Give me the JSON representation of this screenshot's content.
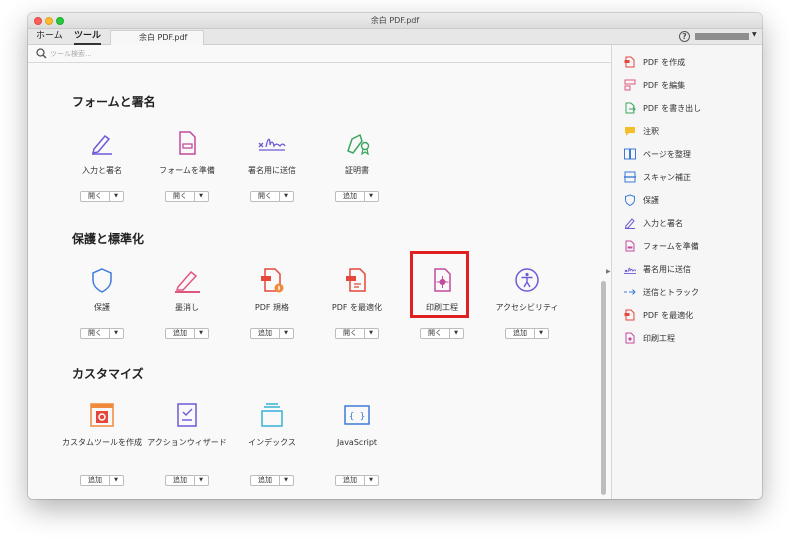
{
  "window": {
    "title": "余白 PDF.pdf"
  },
  "nav": {
    "home": "ホーム",
    "tools": "ツール",
    "doc_tab": "余白 PDF.pdf",
    "help": "?"
  },
  "search": {
    "placeholder": "ツール検索..."
  },
  "sections": [
    {
      "title": "フォームと署名",
      "tools": [
        {
          "name": "入力と署名",
          "button": "開く",
          "icon": "pen-sign-icon"
        },
        {
          "name": "フォームを準備",
          "button": "開く",
          "icon": "form-document-icon"
        },
        {
          "name": "署名用に送信",
          "button": "開く",
          "icon": "signature-icon"
        },
        {
          "name": "証明書",
          "button": "追加",
          "icon": "certificate-pen-icon"
        }
      ]
    },
    {
      "title": "保護と標準化",
      "tools": [
        {
          "name": "保護",
          "button": "開く",
          "icon": "shield-icon"
        },
        {
          "name": "墨消し",
          "button": "追加",
          "icon": "redact-marker-icon"
        },
        {
          "name": "PDF 規格",
          "button": "追加",
          "icon": "pdf-standards-icon"
        },
        {
          "name": "PDF を最適化",
          "button": "開く",
          "icon": "optimize-pdf-icon"
        },
        {
          "name": "印刷工程",
          "button": "開く",
          "icon": "print-production-icon"
        },
        {
          "name": "アクセシビリティ",
          "button": "追加",
          "icon": "accessibility-icon"
        }
      ]
    },
    {
      "title": "カスタマイズ",
      "tools": [
        {
          "name": "カスタムツールを作成",
          "button": "追加",
          "icon": "custom-tool-gear-icon"
        },
        {
          "name": "アクションウィザード",
          "button": "追加",
          "icon": "action-wizard-icon"
        },
        {
          "name": "インデックス",
          "button": "追加",
          "icon": "index-tray-icon"
        },
        {
          "name": "JavaScript",
          "button": "追加",
          "icon": "javascript-braces-icon"
        }
      ]
    }
  ],
  "right_panel": [
    {
      "label": "PDF を作成",
      "icon": "create-pdf-icon",
      "color": "#e5473a"
    },
    {
      "label": "PDF を編集",
      "icon": "edit-pdf-icon",
      "color": "#e0577e"
    },
    {
      "label": "PDF を書き出し",
      "icon": "export-pdf-icon",
      "color": "#3aa55f"
    },
    {
      "label": "注釈",
      "icon": "comment-icon",
      "color": "#f2bf2a"
    },
    {
      "label": "ページを整理",
      "icon": "organize-pages-icon",
      "color": "#3d7bd8"
    },
    {
      "label": "スキャン補正",
      "icon": "scan-icon",
      "color": "#3d7bd8"
    },
    {
      "label": "保護",
      "icon": "shield-icon",
      "color": "#3d7bd8"
    },
    {
      "label": "入力と署名",
      "icon": "pen-sign-icon",
      "color": "#6b5bd6"
    },
    {
      "label": "フォームを準備",
      "icon": "form-document-icon",
      "color": "#c34a9e"
    },
    {
      "label": "署名用に送信",
      "icon": "signature-icon",
      "color": "#6b5bd6"
    },
    {
      "label": "送信とトラック",
      "icon": "send-track-icon",
      "color": "#3d7bd8"
    },
    {
      "label": "PDF を最適化",
      "icon": "optimize-pdf-icon",
      "color": "#e5473a"
    },
    {
      "label": "印刷工程",
      "icon": "print-production-icon",
      "color": "#c34a9e"
    }
  ],
  "colors": {
    "accent_red": "#e02020",
    "purple": "#6b5bd6",
    "magenta": "#c34a9e",
    "blue": "#3d7bd8",
    "green": "#3aa55f",
    "orange": "#f08a3c"
  }
}
